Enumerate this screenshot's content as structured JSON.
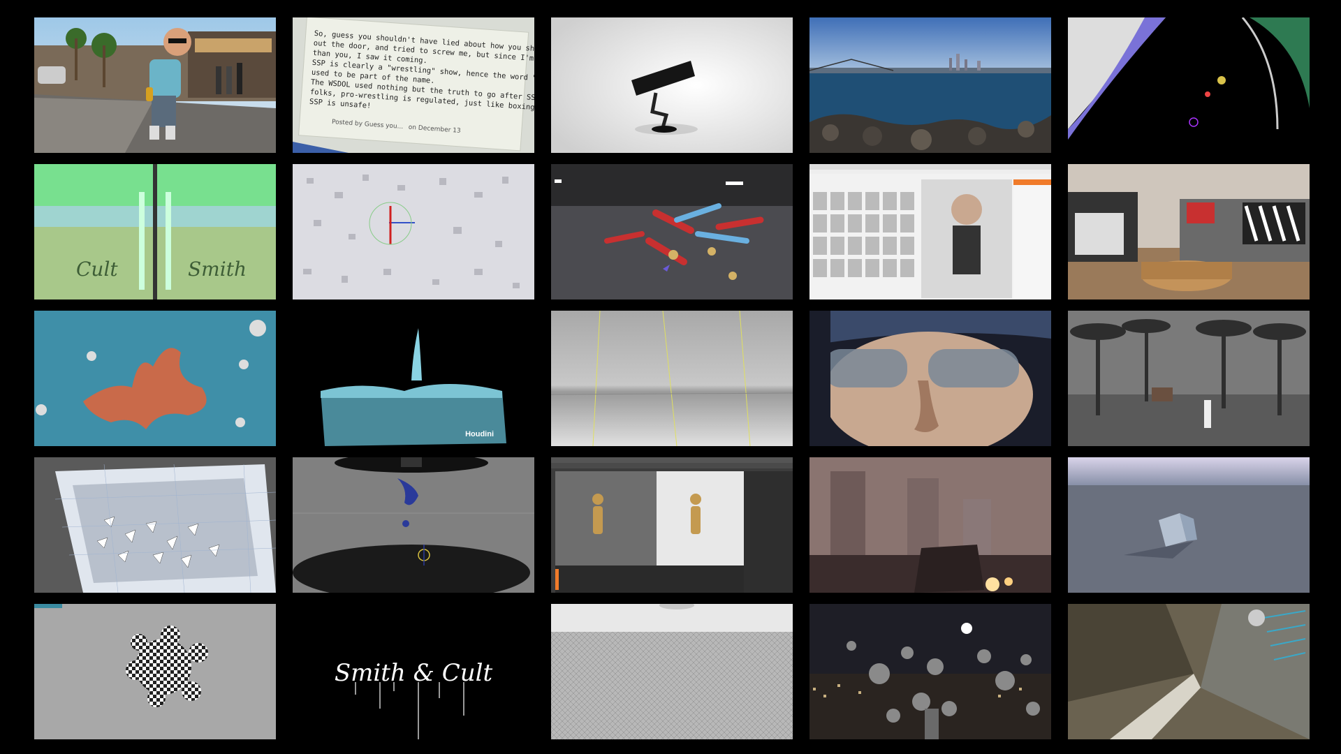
{
  "grid": {
    "rows": 5,
    "columns": 5,
    "background": "#000000"
  },
  "tiles": {
    "street": {
      "label": "street-scene"
    },
    "comment": {
      "lines": [
        "So, guess you shouldn't have lied about how you shoved me",
        "out the door, and tried to screw me, but since I'm smarter",
        "than you, I saw it coming.",
        "SSP is clearly a \"wrestling\" show, hence the word \"wrestling\"",
        "used to be part of the name.",
        "The WSDOL used nothing but the truth to go after SSP, yes",
        "folks, pro-wrestling is regulated, just like boxing, and yes,",
        "SSP is unsafe!"
      ],
      "posted_by": "Posted by Guess you...",
      "posted_on": "on December 13"
    },
    "bottles": {
      "left_text": "Cult",
      "right_text": "Smith"
    },
    "houdini": {
      "logo": "Houdini"
    },
    "signature": {
      "text": "Smith & Cult"
    }
  }
}
